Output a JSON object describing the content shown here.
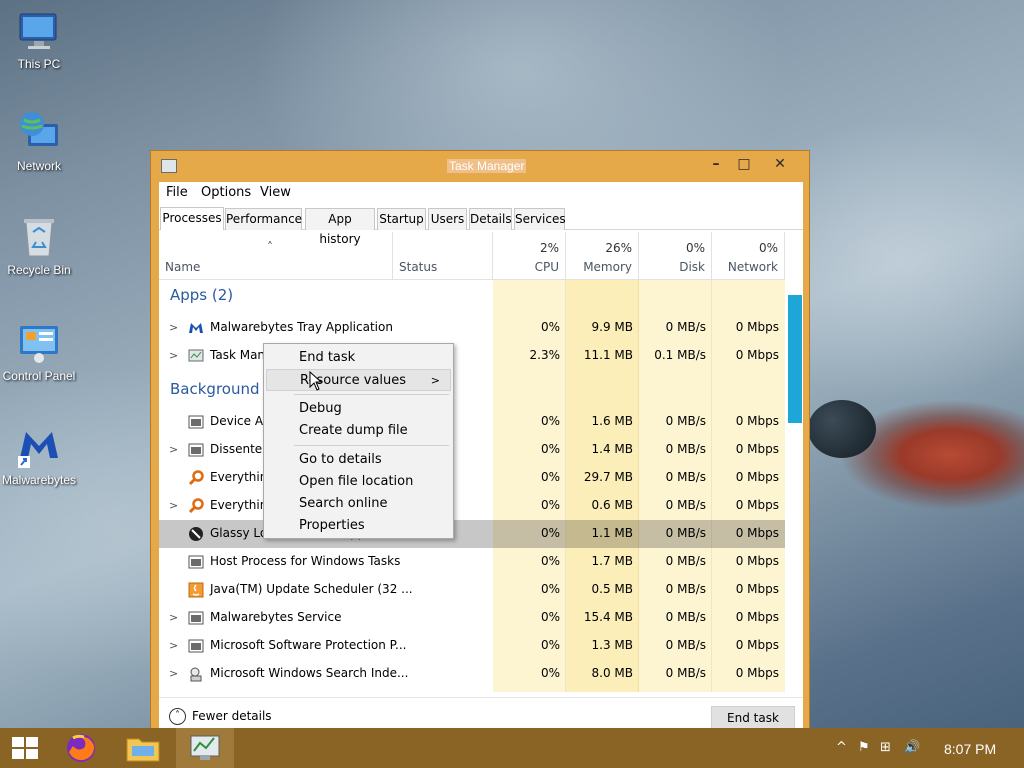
{
  "desktop": {
    "icons": [
      {
        "label": "This PC"
      },
      {
        "label": "Network"
      },
      {
        "label": "Recycle Bin"
      },
      {
        "label": "Control Panel"
      },
      {
        "label": "Malwarebytes"
      }
    ]
  },
  "window": {
    "title": "Task Manager",
    "controls": {
      "minimize": "–",
      "maximize": "□",
      "close": "✕"
    }
  },
  "menu": {
    "file": "File",
    "options": "Options",
    "view": "View"
  },
  "tabs": [
    "Processes",
    "Performance",
    "App history",
    "Startup",
    "Users",
    "Details",
    "Services"
  ],
  "columns": {
    "sort_arrow": "˄",
    "name": "Name",
    "status": "Status",
    "cpu": {
      "pct": "2%",
      "label": "CPU"
    },
    "memory": {
      "pct": "26%",
      "label": "Memory"
    },
    "disk": {
      "pct": "0%",
      "label": "Disk"
    },
    "network": {
      "pct": "0%",
      "label": "Network"
    }
  },
  "groups": {
    "apps": "Apps (2)",
    "background": "Background p"
  },
  "rows": [
    {
      "name": "Malwarebytes Tray Application",
      "cpu": "0%",
      "mem": "9.9 MB",
      "disk": "0 MB/s",
      "net": "0 Mbps"
    },
    {
      "name": "Task Mana",
      "cpu": "2.3%",
      "mem": "11.1 MB",
      "disk": "0.1 MB/s",
      "net": "0 Mbps"
    },
    {
      "name": "Device Ass",
      "cpu": "0%",
      "mem": "1.6 MB",
      "disk": "0 MB/s",
      "net": "0 Mbps"
    },
    {
      "name": "DissenterU",
      "cpu": "0%",
      "mem": "1.4 MB",
      "disk": "0 MB/s",
      "net": "0 Mbps"
    },
    {
      "name": "Everything",
      "cpu": "0%",
      "mem": "29.7 MB",
      "disk": "0 MB/s",
      "net": "0 Mbps"
    },
    {
      "name": "Everything",
      "cpu": "0%",
      "mem": "0.6 MB",
      "disk": "0 MB/s",
      "net": "0 Mbps"
    },
    {
      "name": "Glassy Look for Black Apps (32 ...",
      "cpu": "0%",
      "mem": "1.1 MB",
      "disk": "0 MB/s",
      "net": "0 Mbps"
    },
    {
      "name": "Host Process for Windows Tasks",
      "cpu": "0%",
      "mem": "1.7 MB",
      "disk": "0 MB/s",
      "net": "0 Mbps"
    },
    {
      "name": "Java(TM) Update Scheduler (32 ...",
      "cpu": "0%",
      "mem": "0.5 MB",
      "disk": "0 MB/s",
      "net": "0 Mbps"
    },
    {
      "name": "Malwarebytes Service",
      "cpu": "0%",
      "mem": "15.4 MB",
      "disk": "0 MB/s",
      "net": "0 Mbps"
    },
    {
      "name": "Microsoft Software Protection P...",
      "cpu": "0%",
      "mem": "1.3 MB",
      "disk": "0 MB/s",
      "net": "0 Mbps"
    },
    {
      "name": "Microsoft Windows Search Inde...",
      "cpu": "0%",
      "mem": "8.0 MB",
      "disk": "0 MB/s",
      "net": "0 Mbps"
    }
  ],
  "context_menu": {
    "end_task": "End task",
    "resource_values": "Resource values",
    "submenu_arrow": ">",
    "debug": "Debug",
    "create_dump": "Create dump file",
    "go_to_details": "Go to details",
    "open_file_location": "Open file location",
    "search_online": "Search online",
    "properties": "Properties"
  },
  "footer": {
    "fewer_details": "Fewer details",
    "fewer_glyph": "˄",
    "end_task": "End task"
  },
  "taskbar": {
    "clock": "8:07 PM"
  },
  "colors": {
    "accent": "#e6a94a",
    "taskbar": "#8a6424",
    "group_text": "#2a5aa0",
    "scroll_thumb": "#1ca7d8"
  }
}
